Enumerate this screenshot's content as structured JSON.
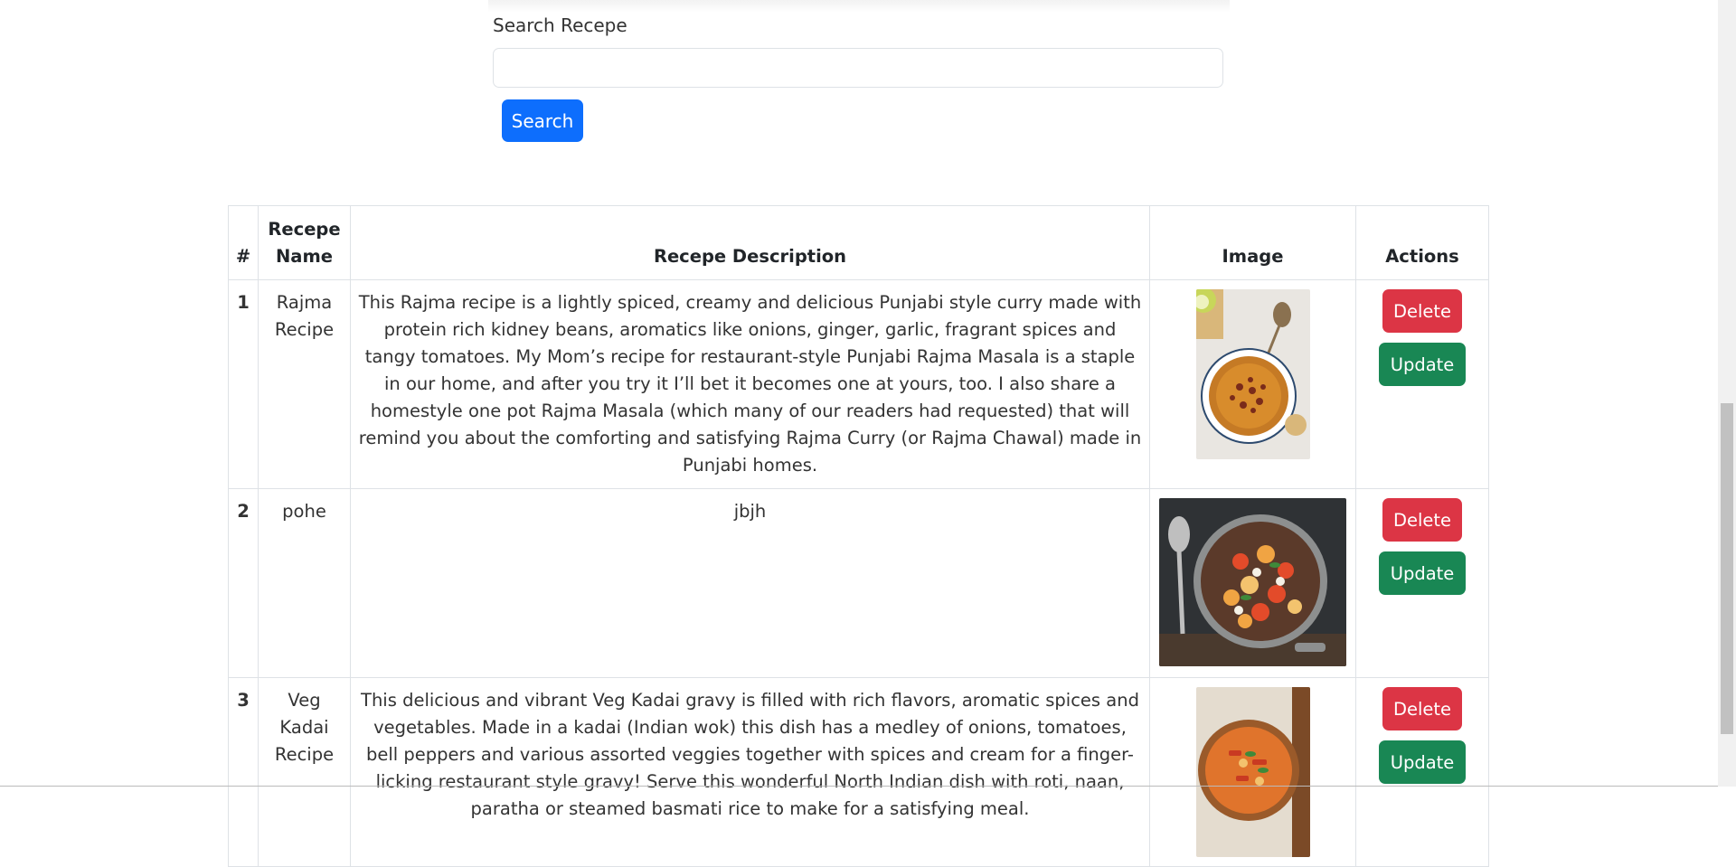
{
  "search": {
    "label": "Search Recepe",
    "value": "",
    "placeholder": "",
    "button_label": "Search"
  },
  "table": {
    "headers": [
      "#",
      "Recepe Name",
      "Recepe Description",
      "Image",
      "Actions"
    ],
    "rows": [
      {
        "num": "1",
        "name": "Rajma Recipe",
        "description": "This Rajma recipe is a lightly spiced, creamy and delicious Punjabi style curry made with protein rich kidney beans, aromatics like onions, ginger, garlic, fragrant spices and tangy tomatoes. My Mom’s recipe for restaurant-style Punjabi Rajma Masala is a staple in our home, and after you try it I’ll bet it becomes one at yours, too. I also share a homestyle one pot Rajma Masala (which many of our readers had requested) that will remind you about the comforting and satisfying Rajma Curry (or Rajma Chawal) made in Punjabi homes.",
        "image_icon": "rajma-curry-bowl-photo",
        "delete_label": "Delete",
        "update_label": "Update"
      },
      {
        "num": "2",
        "name": "pohe",
        "description": "jbjh",
        "image_icon": "vegetable-pan-photo",
        "delete_label": "Delete",
        "update_label": "Update"
      },
      {
        "num": "3",
        "name": "Veg Kadai Recipe",
        "description": "This delicious and vibrant Veg Kadai gravy is filled with rich flavors, aromatic spices and vegetables. Made in a kadai (Indian wok) this dish has a medley of onions, tomatoes, bell peppers and various assorted veggies together with spices and cream for a finger-licking restaurant style gravy! Serve this wonderful North Indian dish with roti, naan, paratha or steamed basmati rice to make for a satisfying meal.",
        "image_icon": "veg-kadai-pot-photo",
        "delete_label": "Delete",
        "update_label": "Update"
      }
    ]
  },
  "colors": {
    "primary": "#0d6efd",
    "danger": "#dc3545",
    "success": "#198754",
    "border": "#dee2e6"
  }
}
